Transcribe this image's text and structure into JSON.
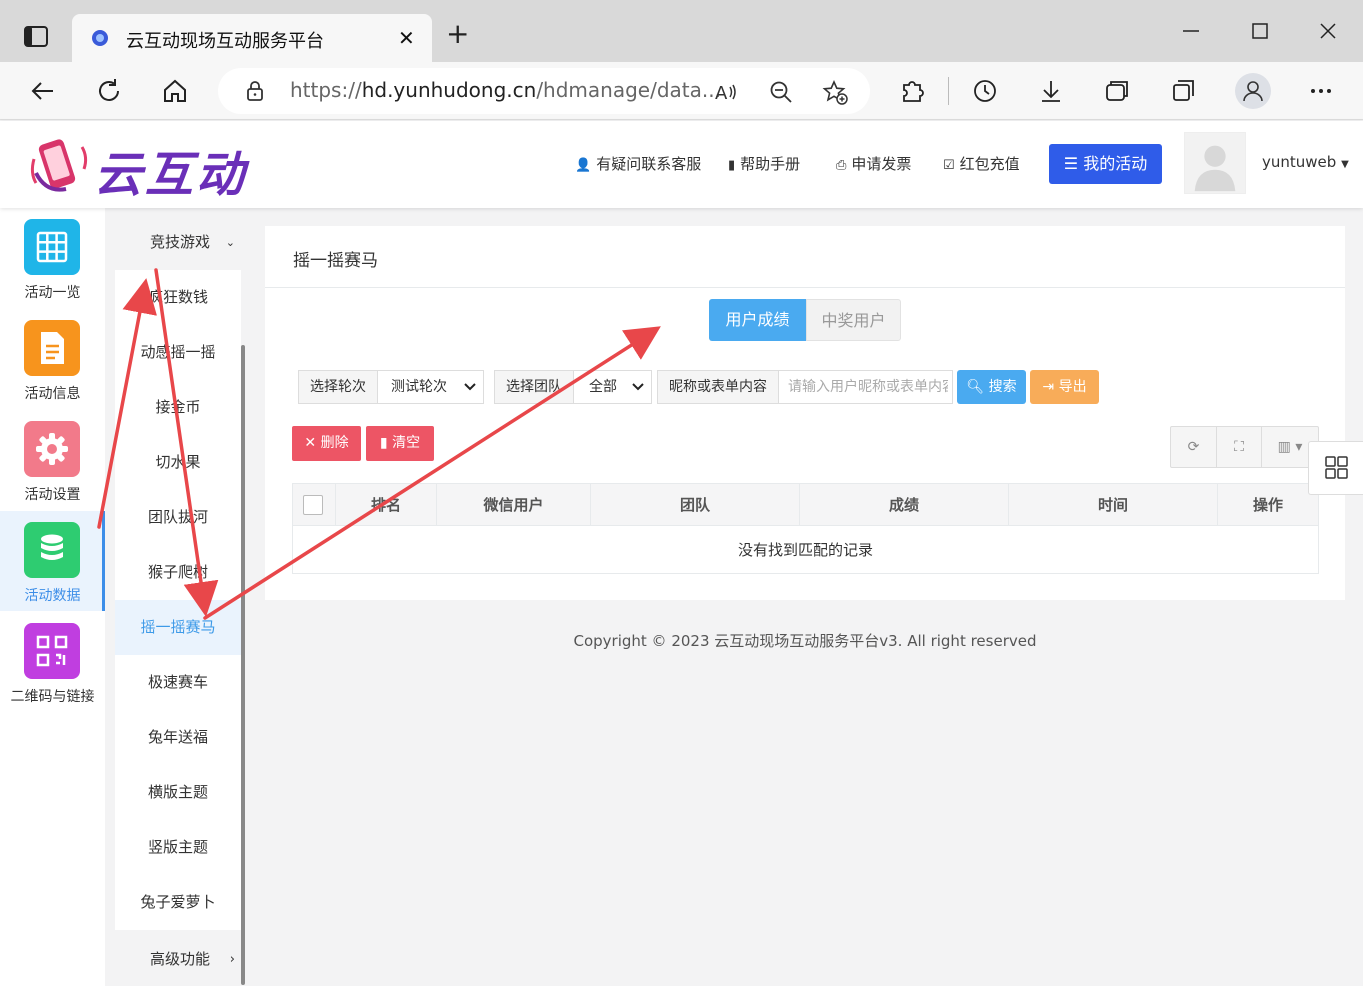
{
  "browser": {
    "tab_title": "云互动现场互动服务平台",
    "url_prefix": "https://",
    "url_host": "hd.yunhudong.cn",
    "url_path": "/hdmanage/data..."
  },
  "header": {
    "logo_text": "云互动",
    "nav": [
      "有疑问联系客服",
      "帮助手册",
      "申请发票",
      "红包充值"
    ],
    "my_activity": "我的活动",
    "username": "yuntuweb"
  },
  "sidebar": {
    "items": [
      {
        "label": "活动一览",
        "color": "#1fb5e8",
        "icon": "grid-icon"
      },
      {
        "label": "活动信息",
        "color": "#f7941d",
        "icon": "document-icon"
      },
      {
        "label": "活动设置",
        "color": "#f27a8a",
        "icon": "gear-icon"
      },
      {
        "label": "活动数据",
        "color": "#2ecc71",
        "icon": "database-icon"
      },
      {
        "label": "二维码与链接",
        "color": "#c03ee0",
        "icon": "qrcode-icon"
      }
    ],
    "active_index": 3
  },
  "submenu": {
    "header": "竞技游戏",
    "items": [
      "疯狂数钱",
      "动感摇一摇",
      "接金币",
      "切水果",
      "团队拔河",
      "猴子爬树",
      "摇一摇赛马",
      "极速赛车",
      "兔年送福",
      "横版主题",
      "竖版主题",
      "兔子爱萝卜"
    ],
    "active_index": 6,
    "footer": "高级功能"
  },
  "main": {
    "title": "摇一摇赛马",
    "segments": {
      "on": "用户成绩",
      "off": "中奖用户"
    },
    "filters": {
      "round_label": "选择轮次",
      "round_value": "测试轮次",
      "team_label": "选择团队",
      "team_value": "全部",
      "keyword_label": "昵称或表单内容",
      "keyword_placeholder": "请输入用户昵称或表单内容"
    },
    "search_btn": "搜索",
    "export_btn": "导出",
    "delete_btn": "删除",
    "clear_btn": "清空",
    "columns": [
      "排名",
      "微信用户",
      "团队",
      "成绩",
      "时间",
      "操作"
    ],
    "empty_text": "没有找到匹配的记录"
  },
  "footer": {
    "copyright": "Copyright © 2023 云互动现场互动服务平台v3. All right reserved"
  },
  "annotation_color": "#e8474a"
}
